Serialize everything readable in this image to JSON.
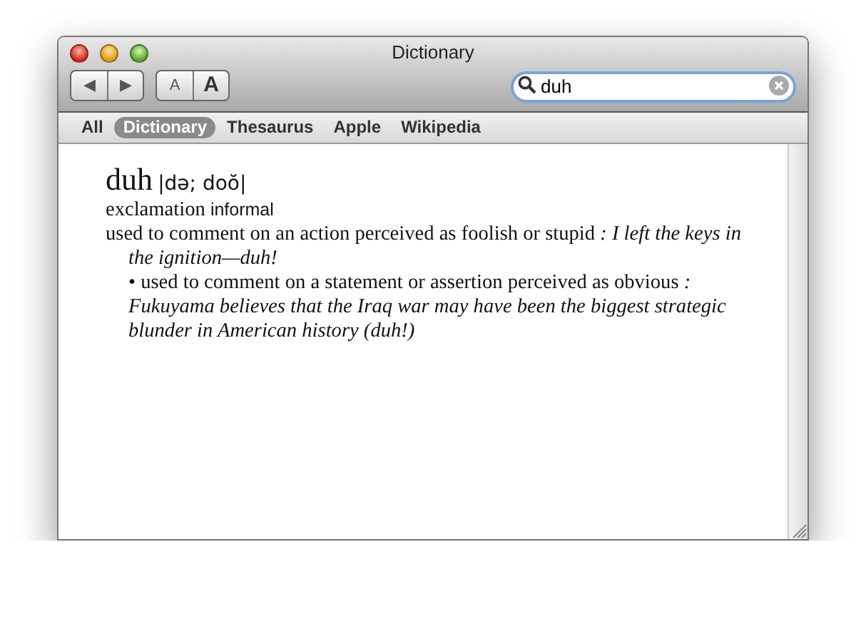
{
  "window": {
    "title": "Dictionary"
  },
  "toolbar": {
    "nav_buttons": [
      "◀",
      "▶"
    ],
    "font_buttons": [
      "A",
      "A"
    ],
    "search": {
      "value": "duh"
    }
  },
  "sources": [
    {
      "label": "All",
      "selected": false
    },
    {
      "label": "Dictionary",
      "selected": true
    },
    {
      "label": "Thesaurus",
      "selected": false
    },
    {
      "label": "Apple",
      "selected": false
    },
    {
      "label": "Wikipedia",
      "selected": false
    }
  ],
  "entry": {
    "headword": "duh",
    "pronunciation": "|də; doŏ|",
    "part_of_speech": "exclamation",
    "register": "informal",
    "senses": [
      {
        "kind": "main",
        "text": "used to comment on an action perceived as foolish or stupid *: I left the keys in the ignition—duh!*"
      },
      {
        "kind": "sub",
        "bullet": "•",
        "text": "used to comment on a statement or assertion perceived as obvious *: Fukuyama believes that the Iraq war may have been the biggest strategic blunder in American history (duh!)*"
      }
    ]
  }
}
